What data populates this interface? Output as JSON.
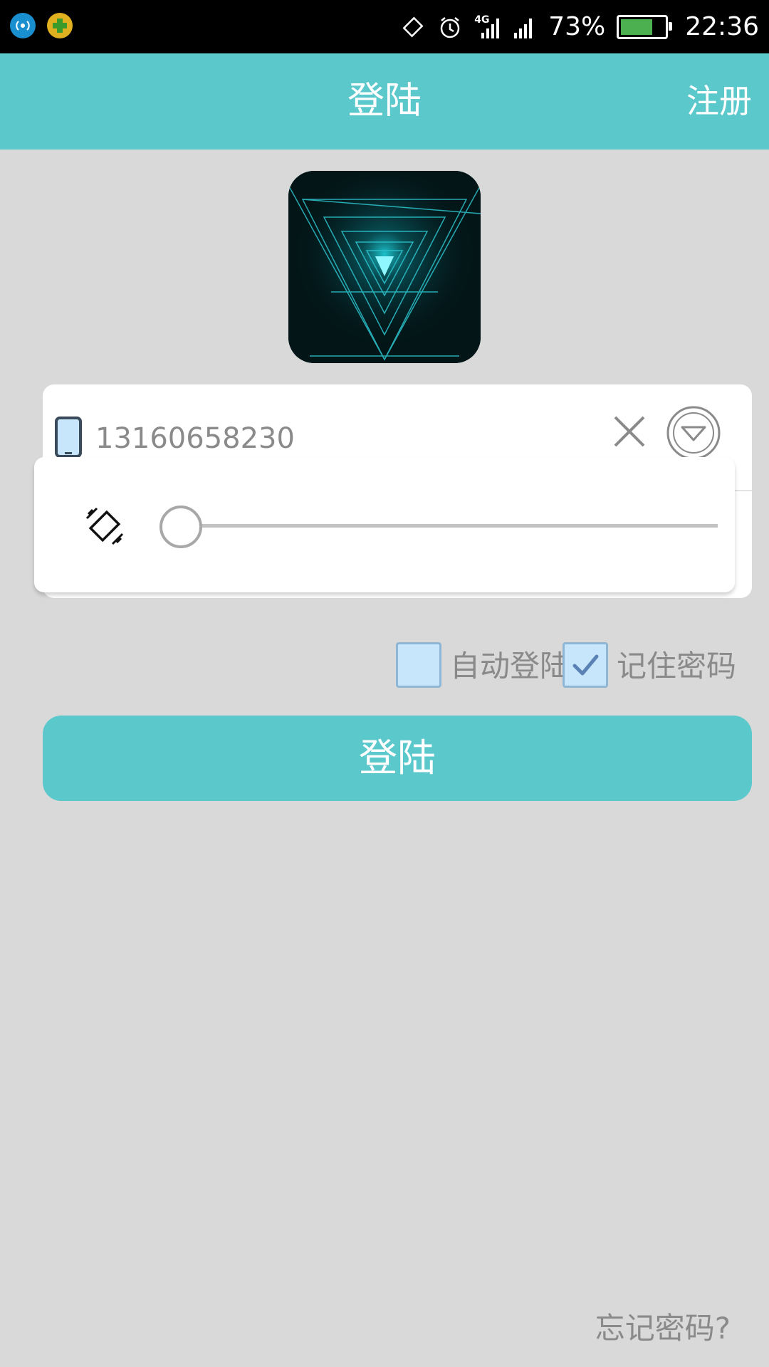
{
  "status_bar": {
    "battery_percent": "73%",
    "battery_level": 0.73,
    "time": "22:36",
    "network_label": "4G",
    "icons": [
      "hotspot-icon",
      "app-plus-icon",
      "rotation-lock-icon",
      "alarm-icon",
      "signal-4g-icon",
      "signal-icon",
      "battery-icon"
    ]
  },
  "app_bar": {
    "title": "登陆",
    "action": "注册"
  },
  "form": {
    "phone_value": "13160658230",
    "clear_icon": "close-icon",
    "dropdown_icon": "chevron-down-icon"
  },
  "popup": {
    "icon": "vibrate-icon",
    "slider_value": 0
  },
  "options": {
    "auto_login_label": "自动登陆",
    "auto_login_checked": false,
    "remember_label": "记住密码",
    "remember_checked": true
  },
  "login_button": "登陆",
  "forgot_link": "忘记密码?",
  "colors": {
    "accent": "#5bc8cc",
    "background": "#d9d9d9",
    "checkbox_fill": "#c7e6fb"
  }
}
